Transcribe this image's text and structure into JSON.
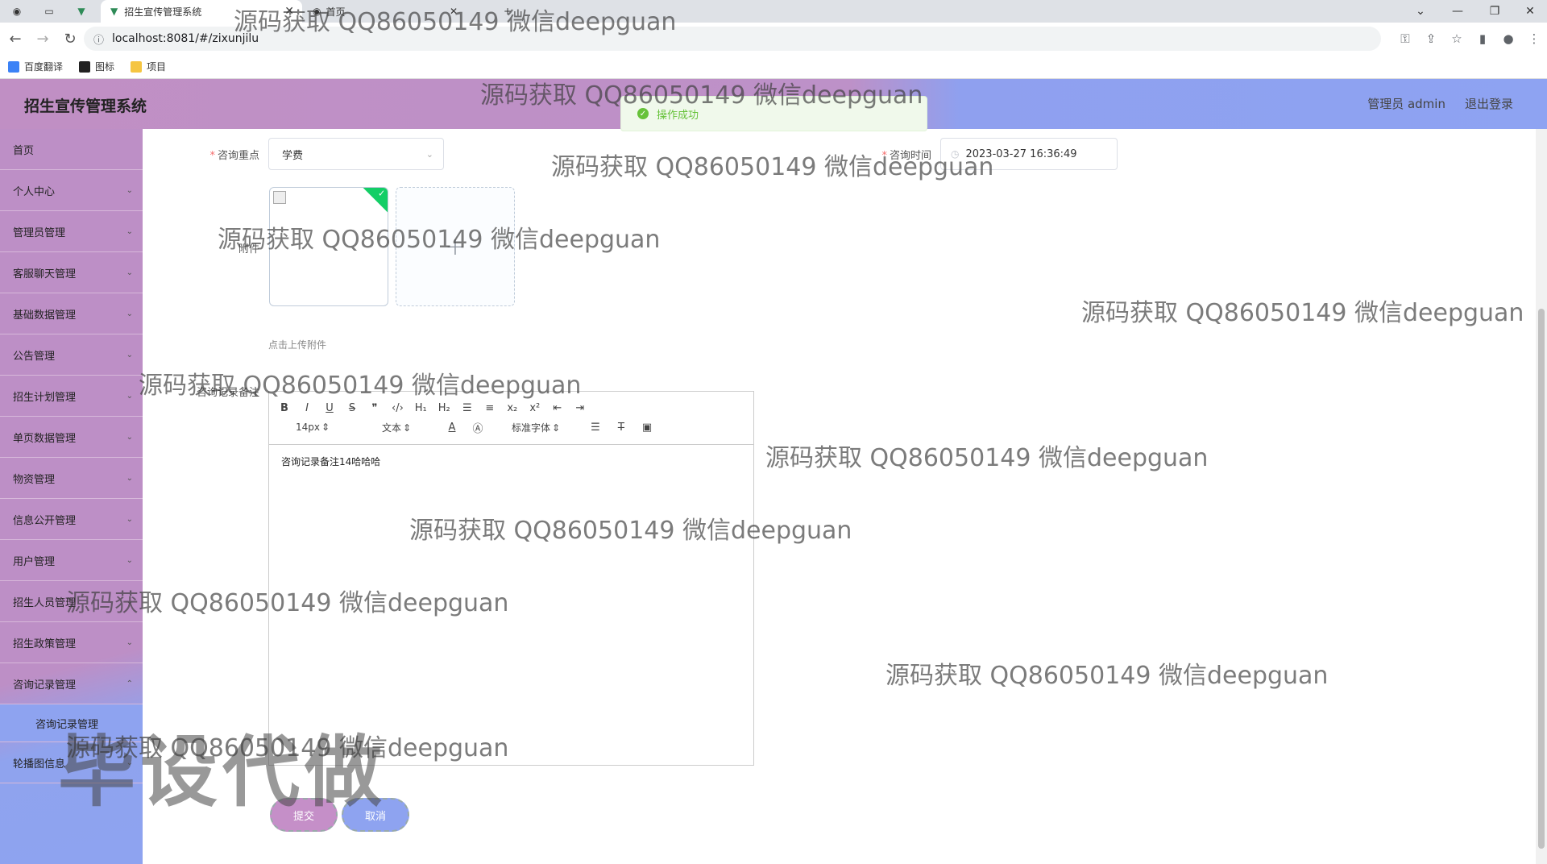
{
  "browser": {
    "active_tab_title": "招生宣传管理系统",
    "second_tab_title": "首页",
    "new_tab_label": "+",
    "url": "localhost:8081/#/zixunjilu",
    "bookmarks": [
      "百度翻译",
      "图标",
      "项目"
    ]
  },
  "header": {
    "title": "招生宣传管理系统",
    "user_label": "管理员 admin",
    "logout_label": "退出登录"
  },
  "toast": {
    "message": "操作成功"
  },
  "sidebar": {
    "items": [
      {
        "label": "首页",
        "chevron": false
      },
      {
        "label": "个人中心",
        "chevron": true
      },
      {
        "label": "管理员管理",
        "chevron": true
      },
      {
        "label": "客服聊天管理",
        "chevron": true
      },
      {
        "label": "基础数据管理",
        "chevron": true
      },
      {
        "label": "公告管理",
        "chevron": true
      },
      {
        "label": "招生计划管理",
        "chevron": true
      },
      {
        "label": "单页数据管理",
        "chevron": true
      },
      {
        "label": "物资管理",
        "chevron": true
      },
      {
        "label": "信息公开管理",
        "chevron": true
      },
      {
        "label": "用户管理",
        "chevron": true
      },
      {
        "label": "招生人员管理",
        "chevron": true
      },
      {
        "label": "招生政策管理",
        "chevron": true
      },
      {
        "label": "咨询记录管理",
        "chevron": true
      }
    ],
    "sub_item": "咨询记录管理",
    "last_item": "轮播图信息"
  },
  "form": {
    "focus_label": "咨询重点",
    "focus_value": "学费",
    "time_label": "咨询时间",
    "time_value": "2023-03-27 16:36:49",
    "attachment_label": "附件",
    "upload_hint": "点击上传附件",
    "remark_label": "咨询记录备注",
    "remark_content": "咨询记录备注14哈哈哈",
    "submit_label": "提交",
    "cancel_label": "取消"
  },
  "editor_toolbar": {
    "row1": [
      "B",
      "I",
      "U",
      "S",
      "❞",
      "‹/›",
      "H₁",
      "H₂",
      "☰",
      "≡",
      "x₂",
      "x²",
      "⇤",
      "⇥"
    ],
    "font_size": "14px",
    "format": "文本",
    "font_family": "标准字体"
  },
  "watermarks": [
    "源码获取 QQ86050149 微信deepguan",
    "源码获取 QQ86050149 微信deepguan",
    "源码获取 QQ86050149 微信deepguan",
    "源码获取 QQ86050149 微信deepguan",
    "源码获取 QQ86050149 微信deepguan",
    "源码获取 QQ86050149 微信deepguan",
    "源码获取 QQ86050149 微信deepguan",
    "源码获取 QQ86050149 微信deepguan",
    "源码获取 QQ86050149 微信deepguan",
    "源码获取 QQ86050149 微信deepguan",
    "源码获取 QQ86050149 微信deepguan"
  ],
  "big_watermark": "毕设代做",
  "colors": {
    "header_purple": "#bd8fc6",
    "header_blue": "#8ea3f0",
    "success": "#67c23a"
  }
}
